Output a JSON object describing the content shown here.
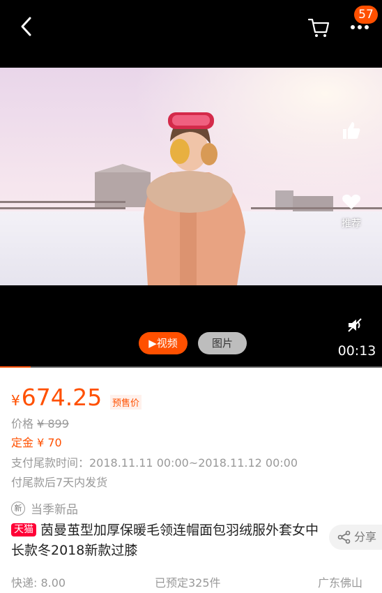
{
  "header": {
    "cart_badge": "57"
  },
  "icons": {
    "back": "chevron-left-icon",
    "cart": "shopping-cart-icon",
    "more": "more-dots-icon",
    "like": "thumbs-up-icon",
    "recommend": "recommend-icon",
    "mute": "mute-icon",
    "share": "share-icon"
  },
  "video": {
    "side_recommend_label": "推荐",
    "timer": "00:13",
    "tab_video": "▶视频",
    "tab_image": "图片",
    "progress": 0.08
  },
  "product": {
    "currency": "¥",
    "price": "674.25",
    "presale_tag": "预售价",
    "original_label": "价格",
    "original_price": "¥ 899",
    "deposit": "定金 ¥ 70",
    "pay_time": "支付尾款时间：2018.11.11 00:00~2018.11.12 00:00",
    "ship_note": "付尾款后7天内发货",
    "season_icon_text": "新",
    "season_label": "当季新品",
    "store_tag": "天猫",
    "title": "茵曼茧型加厚保暖毛领连帽面包羽绒服外套女中长款冬2018新款过膝",
    "share_label": "分享",
    "shipping": "快递: 8.00",
    "sold": "已预定325件",
    "location": "广东佛山"
  },
  "colors": {
    "accent": "#ff5000",
    "tmall": "#ff0036"
  }
}
